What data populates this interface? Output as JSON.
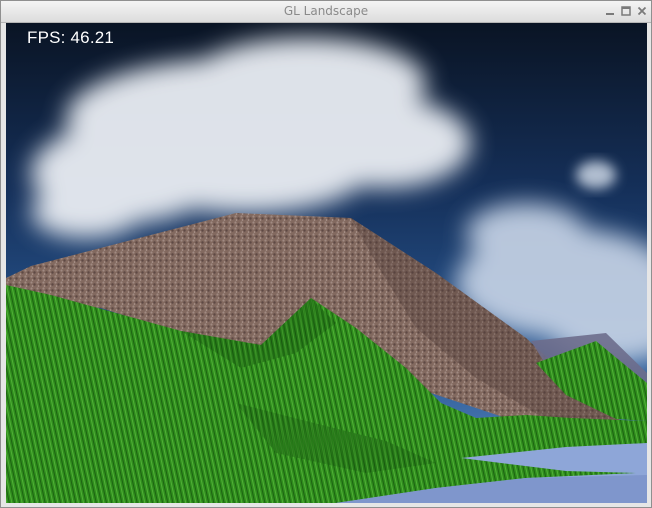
{
  "window": {
    "title": "GL Landscape",
    "controls": {
      "minimize_icon": "minimize-icon",
      "maximize_icon": "maximize-icon",
      "close_icon": "close-icon"
    }
  },
  "overlay": {
    "fps_text": "FPS: 46.21"
  },
  "scene": {
    "sky_color": "#0e1d33",
    "cloud_color": "#e8ecf2",
    "rock_color": "#8a6f6a",
    "grass_color": "#2e8a1c",
    "water_color": "#8ea6d8"
  }
}
